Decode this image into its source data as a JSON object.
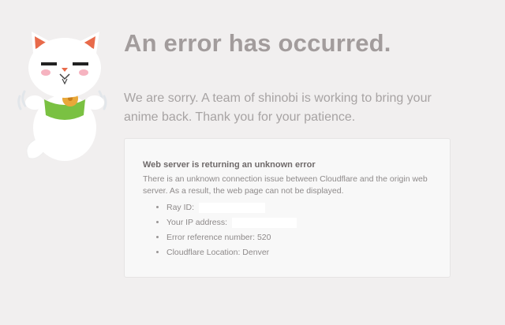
{
  "title": "An error has occurred.",
  "subtitle": "We are sorry. A team of shinobi is working to bring your anime back. Thank you for your patience.",
  "card": {
    "heading": "Web server is returning an unknown error",
    "description": "There is an unknown connection issue between Cloudflare and the origin web server. As a result, the web page can not be displayed.",
    "details": {
      "ray_id_label": "Ray ID:",
      "ip_label": "Your IP address:",
      "error_ref": "Error reference number: 520",
      "location": "Cloudflare Location: Denver"
    }
  },
  "colors": {
    "background": "#f1efef",
    "title": "#a29c9c",
    "card_background": "#f8f8f8",
    "mascot_collar": "#7ac142",
    "mascot_bell": "#e9a83a",
    "mascot_ears": "#e86a4a"
  },
  "icons": {
    "mascot": "lucky-cat-mascot-icon"
  }
}
